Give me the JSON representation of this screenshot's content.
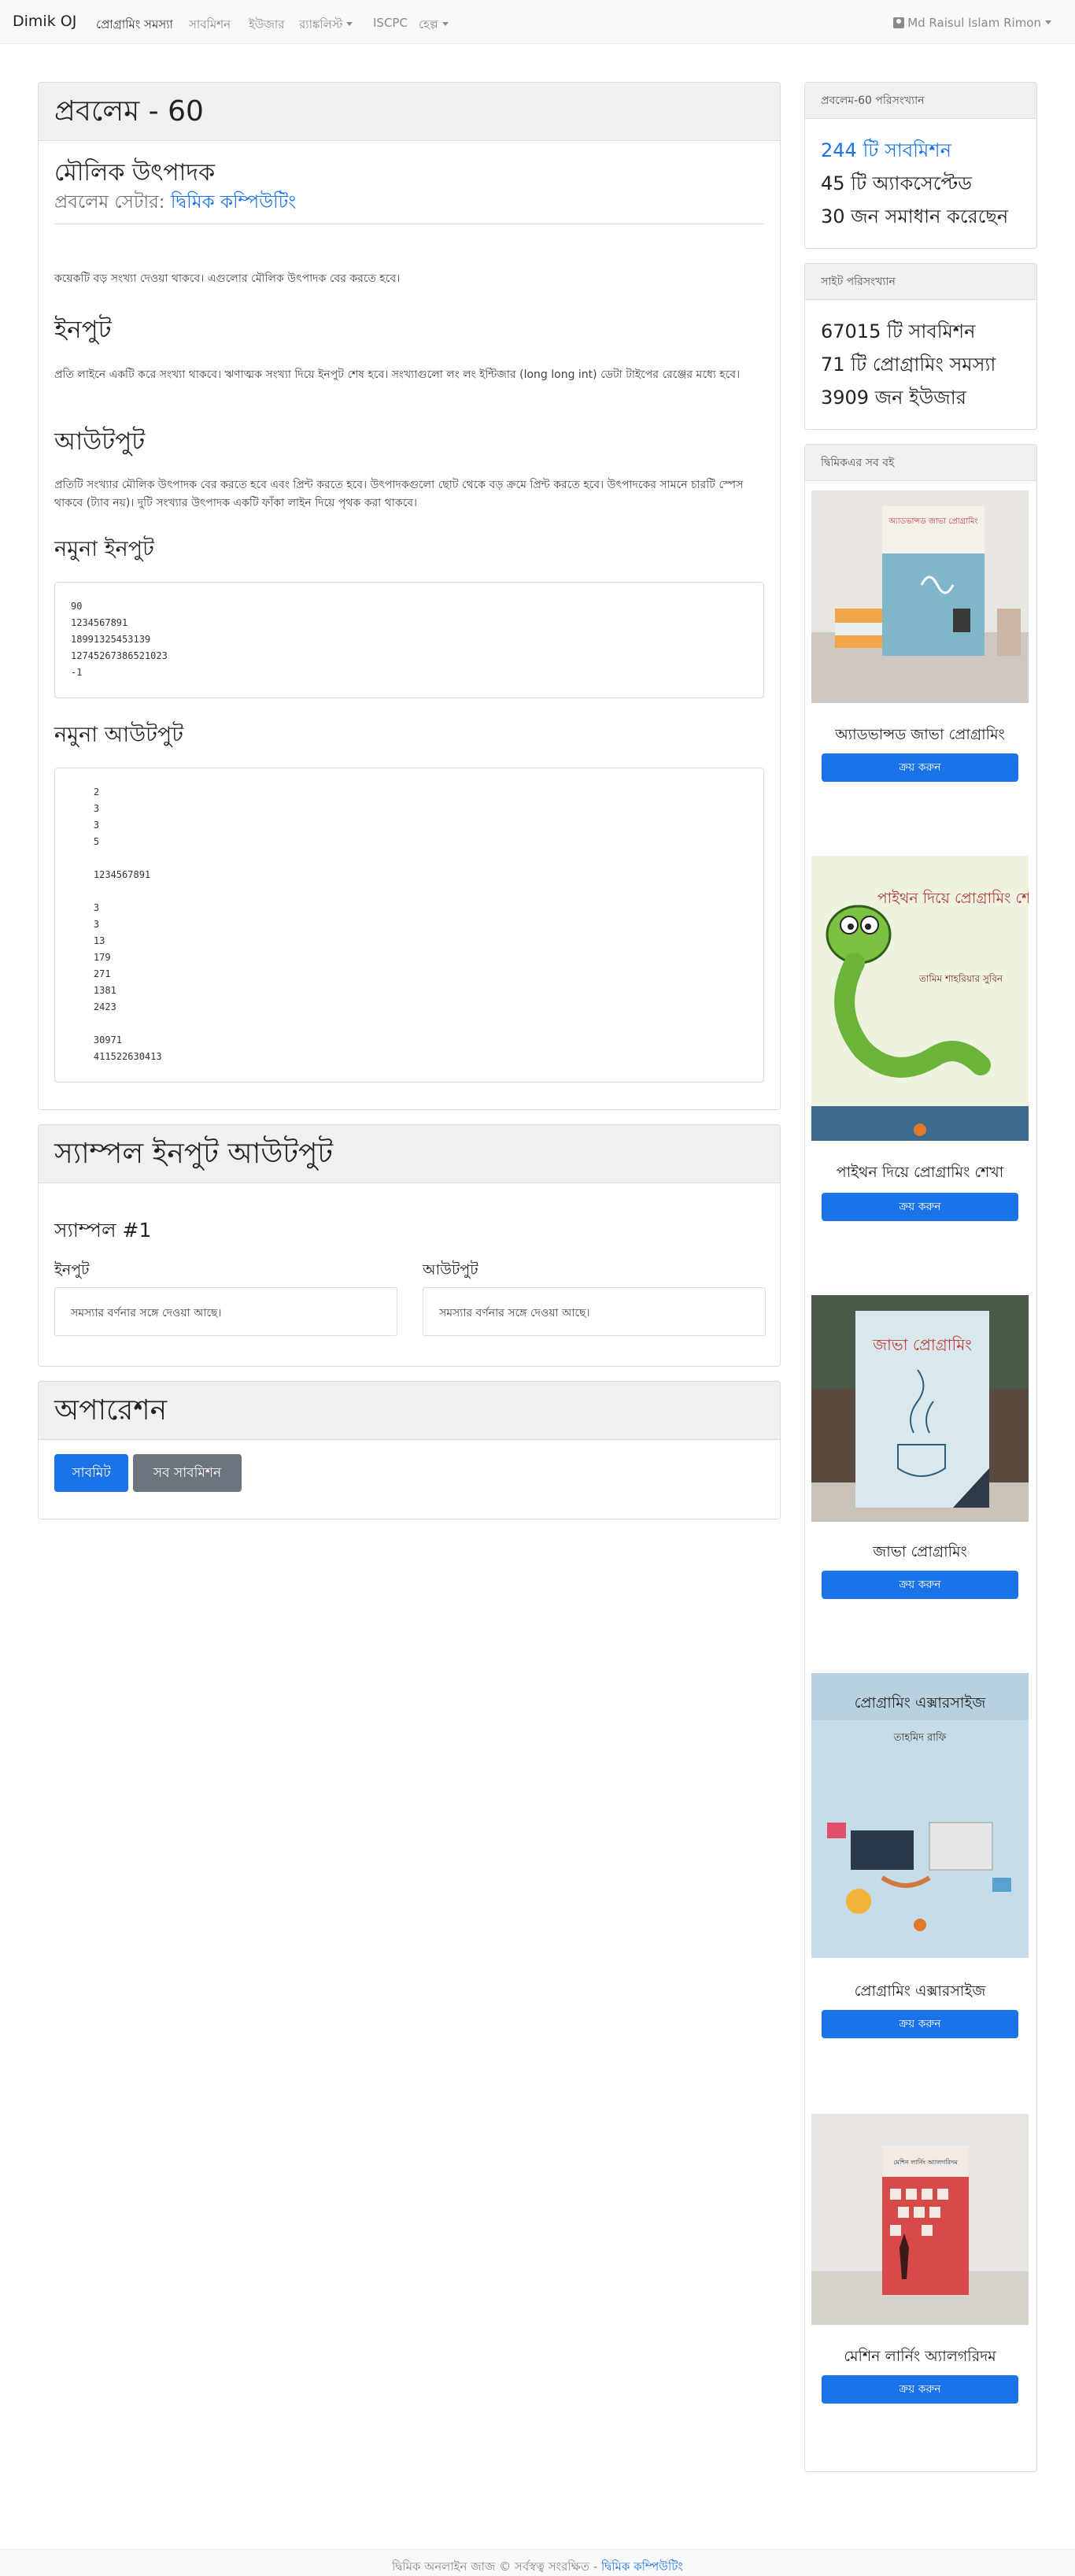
{
  "navbar": {
    "brand": "Dimik OJ",
    "items": [
      "প্রোগ্রামিং সমস্যা",
      "সাবমিশন",
      "ইউজার",
      "র‍্যাঙ্কলিস্ট",
      "ISCPC",
      "হেল্প"
    ],
    "user": "Md Raisul Islam Rimon"
  },
  "problem": {
    "header": "প্রবলেম - 60",
    "title": "মৌলিক উৎপাদক",
    "setter_label": "প্রবলেম সেটার: ",
    "setter_name": "দ্বিমিক কম্পিউটিং",
    "statement": "কয়েকটি বড় সংখ্যা দেওয়া থাকবে। এগুলোর মৌলিক উৎপাদক বের করতে হবে।",
    "input_heading": "ইনপুট",
    "input_text": "প্রতি লাইনে একটি করে সংখ্যা থাকবে। ঋণাত্মক সংখ্যা দিয়ে ইনপুট শেষ হবে। সংখ্যাগুলো লং লং ইন্টিজার (long long int) ডেটা টাইপের রেঞ্জের মধ্যে হবে।",
    "output_heading": "আউটপুট",
    "output_text": "প্রতিটি সংখ্যার মৌলিক উৎপাদক বের করতে হবে এবং প্রিন্ট করতে হবে। উৎপাদকগুলো ছোট থেকে বড় ক্রমে প্রিন্ট করতে হবে। উৎপাদকের সামনে চারটি স্পেস থাকবে (ট্যাব নয়)। দুটি সংখ্যার উৎপাদক একটি ফাঁকা লাইন দিয়ে পৃথক করা থাকবে।",
    "sample_input_heading": "নমুনা ইনপুট",
    "sample_input": "90\n1234567891\n18991325453139\n12745267386521023\n-1",
    "sample_output_heading": "নমুনা আউটপুট",
    "sample_output": "    2\n    3\n    3\n    5\n\n    1234567891\n\n    3\n    3\n    13\n    179\n    271\n    1381\n    2423\n\n    30971\n    411522630413"
  },
  "sample_io": {
    "header": "স্যাম্পল ইনপুট আউটপুট",
    "sample_label": "স্যাম্পল #1",
    "input_label": "ইনপুট",
    "output_label": "আউটপুট",
    "input_value": "সমস্যার বর্ণনার সঙ্গে দেওয়া আছে।",
    "output_value": "সমস্যার বর্ণনার সঙ্গে দেওয়া আছে।"
  },
  "operations": {
    "header": "অপারেশন",
    "submit": "সাবমিট",
    "all_submissions": "সব সাবমিশন"
  },
  "problem_stats": {
    "header": "প্রবলেম-60 পরিসংখ্যান",
    "submissions": "244 টি সাবমিশন",
    "accepted": "45 টি অ্যাকসেপ্টেড",
    "solvers": "30 জন সমাধান করেছেন"
  },
  "site_stats": {
    "header": "সাইট পরিসংখ্যান",
    "submissions": "67015 টি সাবমিশন",
    "problems": "71 টি প্রোগ্রামিং সমস্যা",
    "users": "3909 জন ইউজার"
  },
  "books": {
    "header": "দ্বিমিকএর সব বই",
    "buy_label": "ক্রয় করুন",
    "items": [
      {
        "title": "অ্যাডভান্সড জাভা প্রোগ্রামিং",
        "cover_title": "অ্যাডভান্সড জাভা প্রোগ্রামিং",
        "cover_color": "#7fb6c9"
      },
      {
        "title": "পাইথন দিয়ে প্রোগ্রামিং শেখা",
        "cover_title": "পাইথন দিয়ে প্রোগ্রামিং শেখা",
        "cover_author": "তামিম শাহরিয়ার সুবিন",
        "cover_color": "#edf3de"
      },
      {
        "title": "জাভা প্রোগ্রামিং",
        "cover_title": "জাভা প্রোগ্রামিং",
        "cover_color": "#d9e8ec"
      },
      {
        "title": "প্রোগ্রামিং এক্সারসাইজ",
        "cover_title": "প্রোগ্রামিং এক্সারসাইজ",
        "cover_author": "তাহমিদ রাফি",
        "cover_color": "#c6dde9"
      },
      {
        "title": "মেশিন লার্নিং অ্যালগরিদম",
        "cover_title": "মেশিন লার্নিং অ্যালগরিদম",
        "cover_color": "#d84a4a"
      }
    ]
  },
  "footer": {
    "text": "দ্বিমিক অনলাইন জাজ © সর্বস্বত্ব সংরক্ষিত - ",
    "link": "দ্বিমিক কম্পিউটিং"
  },
  "colors": {
    "primary": "#1a73e8",
    "secondary": "#6c757d",
    "header_bg": "#f0f0f0"
  }
}
